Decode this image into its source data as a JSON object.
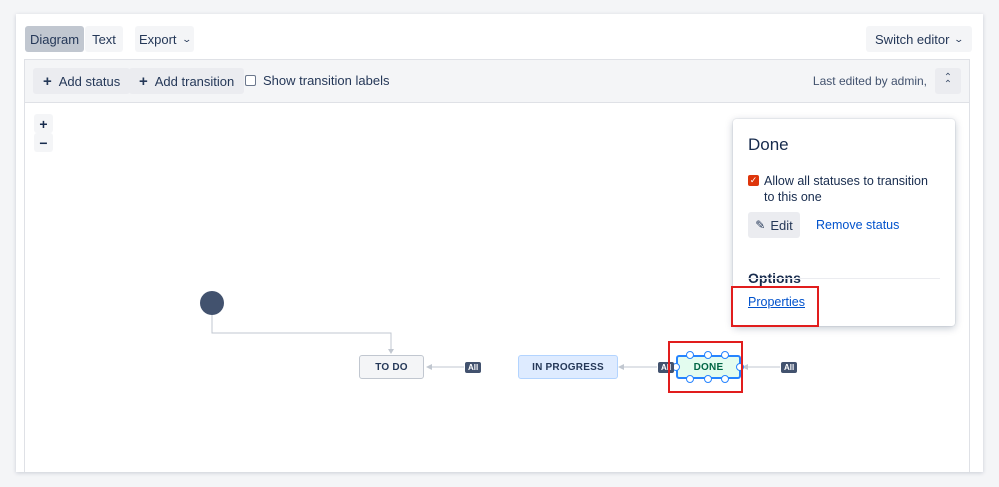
{
  "tabs": {
    "diagram": "Diagram",
    "text": "Text",
    "export": "Export",
    "switch_editor": "Switch editor"
  },
  "toolbar": {
    "add_status": "Add status",
    "add_transition": "Add transition",
    "show_labels": "Show transition labels",
    "last_edited": "Last edited by admin,"
  },
  "zoom": {
    "in": "+",
    "out": "−"
  },
  "statuses": {
    "todo": "TO DO",
    "in_progress": "IN PROGRESS",
    "done": "DONE"
  },
  "badges": {
    "all": "All"
  },
  "panel": {
    "title": "Done",
    "allow_text": "Allow all statuses to transition to this one",
    "edit": "Edit",
    "remove": "Remove status",
    "options_heading": "Options",
    "properties": "Properties"
  },
  "colors": {
    "accent": "#2684ff",
    "highlight": "#e11d1d",
    "link": "#0052cc"
  }
}
